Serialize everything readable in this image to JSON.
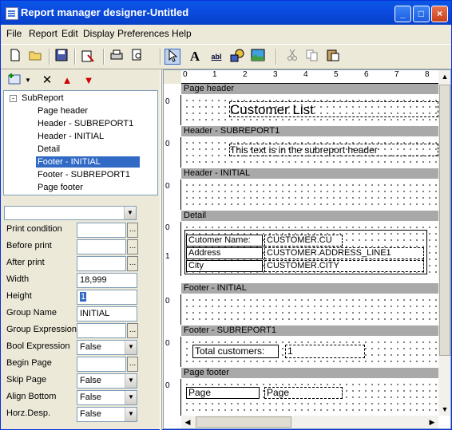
{
  "window": {
    "title": "Report manager designer-Untitled",
    "controls": {
      "minimize": "_",
      "maximize": "□",
      "close": "×"
    }
  },
  "menu": [
    "File",
    "Report",
    "Edit",
    "Display",
    "Preferences",
    "Help"
  ],
  "toolbar": {
    "icons": [
      "new-icon",
      "open-icon",
      "save-icon",
      "config-icon",
      "print-icon",
      "preview-icon",
      "pointer-icon",
      "text-tool-icon",
      "field-tool-icon",
      "shape-tool-icon",
      "image-tool-icon",
      "cut-icon",
      "copy-icon",
      "paste-icon"
    ],
    "labels": {
      "text": "A",
      "field": "abl"
    }
  },
  "left_toolbar": [
    "add-section-icon",
    "dropdown-icon",
    "delete-icon",
    "move-up-icon",
    "move-down-icon"
  ],
  "tree": {
    "root": "SubReport",
    "expander": "-",
    "items": [
      "Page header",
      "Header - SUBREPORT1",
      "Header - INITIAL",
      "Detail",
      "Footer - INITIAL",
      "Footer - SUBREPORT1",
      "Page footer"
    ],
    "selected_index": 4
  },
  "properties": [
    {
      "name": "Print condition",
      "value": "",
      "kind": "ellipsis"
    },
    {
      "name": "Before print",
      "value": "",
      "kind": "ellipsis"
    },
    {
      "name": "After print",
      "value": "",
      "kind": "ellipsis"
    },
    {
      "name": "Width",
      "value": "18,999",
      "kind": "text"
    },
    {
      "name": "Height",
      "value": "1",
      "kind": "text"
    },
    {
      "name": "Group Name",
      "value": "INITIAL",
      "kind": "text"
    },
    {
      "name": "Group Expression",
      "value": "",
      "kind": "ellipsis"
    },
    {
      "name": "Bool Expression",
      "value": "False",
      "kind": "combo"
    },
    {
      "name": "Begin Page",
      "value": "",
      "kind": "ellipsis"
    },
    {
      "name": "Skip Page",
      "value": "False",
      "kind": "combo"
    },
    {
      "name": "Align Bottom",
      "value": "False",
      "kind": "combo"
    },
    {
      "name": "Horz.Desp.",
      "value": "False",
      "kind": "combo"
    }
  ],
  "ruler": [
    "0",
    "1",
    "2",
    "3",
    "4",
    "5",
    "6",
    "7",
    "8"
  ],
  "sections": {
    "page_header": {
      "label": "Page header",
      "ruler": [
        "0"
      ],
      "title": "Customer List"
    },
    "header_sub": {
      "label": "Header - SUBREPORT1",
      "ruler": [
        "0"
      ],
      "text": "This text is in the subreport header"
    },
    "header_initial": {
      "label": "Header - INITIAL",
      "ruler": [
        "0"
      ]
    },
    "detail": {
      "label": "Detail",
      "ruler": [
        "0",
        "1"
      ],
      "labels": [
        "Cutomer Name:",
        "Address",
        "City"
      ],
      "fields": [
        "CUSTOMER.CU",
        "CUSTOMER.ADDRESS_LINE1",
        "CUSTOMER.CITY"
      ]
    },
    "footer_initial": {
      "label": "Footer - INITIAL",
      "ruler": [
        "0"
      ]
    },
    "footer_sub": {
      "label": "Footer - SUBREPORT1",
      "ruler": [
        "0"
      ],
      "text": "Total customers:",
      "value": "1"
    },
    "page_footer": {
      "label": "Page footer",
      "ruler": [
        "0"
      ],
      "text": "Page",
      "value": "Page"
    }
  }
}
